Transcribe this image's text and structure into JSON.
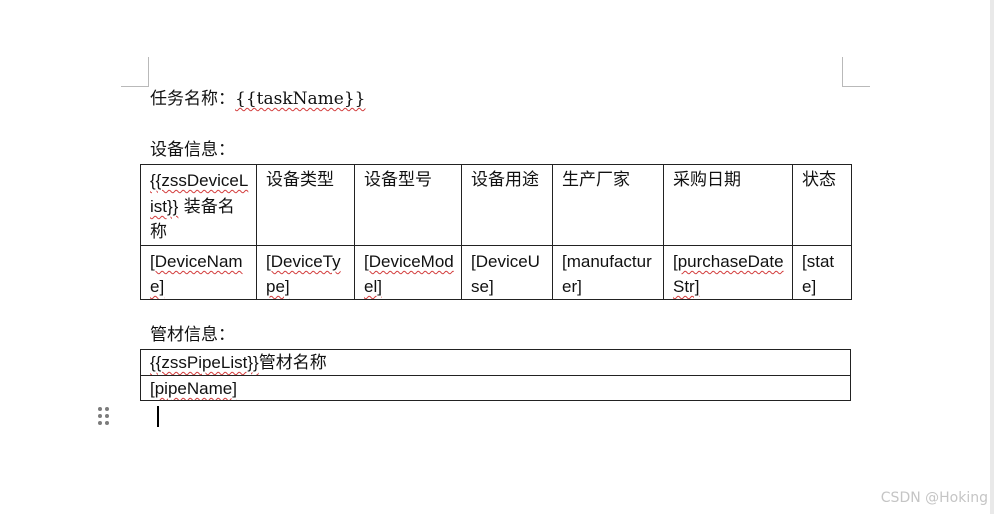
{
  "task": {
    "label": "任务名称：",
    "field": "{{taskName}}"
  },
  "device_section": {
    "heading": "设备信息：",
    "header_cells": [
      {
        "prefix": "{{zssDeviceList}}",
        "text": "装备名称"
      },
      {
        "text": "设备类型"
      },
      {
        "text": "设备型号"
      },
      {
        "text": "设备用途"
      },
      {
        "text": "生产厂家"
      },
      {
        "text": "采购日期"
      },
      {
        "text": "状态"
      }
    ],
    "row_cells": [
      "[DeviceName]",
      "[DeviceType]",
      "[DeviceModel]",
      "[DeviceUse]",
      "[manufacturer]",
      "[purchaseDateStr]",
      "[state]"
    ]
  },
  "pipe_section": {
    "heading": "管材信息：",
    "header_prefix": "{{zssPipeList}}",
    "header_text": "管材名称",
    "row_cell": "[pipeName]"
  },
  "watermark": "CSDN @Hoking"
}
